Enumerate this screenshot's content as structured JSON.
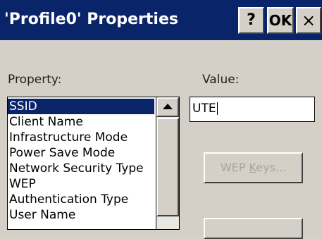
{
  "window": {
    "title": "'Profile0' Properties",
    "help_label": "?",
    "ok_label": "OK",
    "close_label": "×"
  },
  "form": {
    "property_label": "Property:",
    "value_label": "Value:",
    "value": "UTE",
    "wep_keys_prefix": "WEP ",
    "wep_keys_underlined": "K",
    "wep_keys_suffix": "eys..."
  },
  "property_list": {
    "items": [
      "SSID",
      "Client Name",
      "Infrastructure Mode",
      "Power Save Mode",
      "Network Security Type",
      "WEP",
      "Authentication Type",
      "User Name"
    ],
    "selected_index": 0
  },
  "colors": {
    "titlebar": "#0a246a",
    "selection": "#0a246a",
    "dialog_face": "#d4d0c8"
  }
}
